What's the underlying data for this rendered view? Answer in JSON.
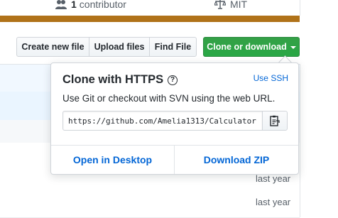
{
  "stats": {
    "contributors_count": "1",
    "contributors_label": "contributor",
    "license": "MIT",
    "language_color": "#b07219"
  },
  "toolbar": {
    "create_new_file": "Create new file",
    "upload_files": "Upload files",
    "find_file": "Find File",
    "clone_or_download": "Clone or download"
  },
  "clone_popover": {
    "title": "Clone with HTTPS",
    "help_icon": "question-icon",
    "use_ssh": "Use SSH",
    "description": "Use Git or checkout with SVN using the web URL.",
    "url": "https://github.com/Amelia1313/Calculator",
    "copy_icon": "clippy-icon",
    "open_in_desktop": "Open in Desktop",
    "download_zip": "Download ZIP"
  },
  "file_list": {
    "ages": [
      "last year",
      "last year"
    ]
  },
  "colors": {
    "accent_link": "#0366d6",
    "primary_button": "#28a745",
    "border": "#d1d5da"
  }
}
